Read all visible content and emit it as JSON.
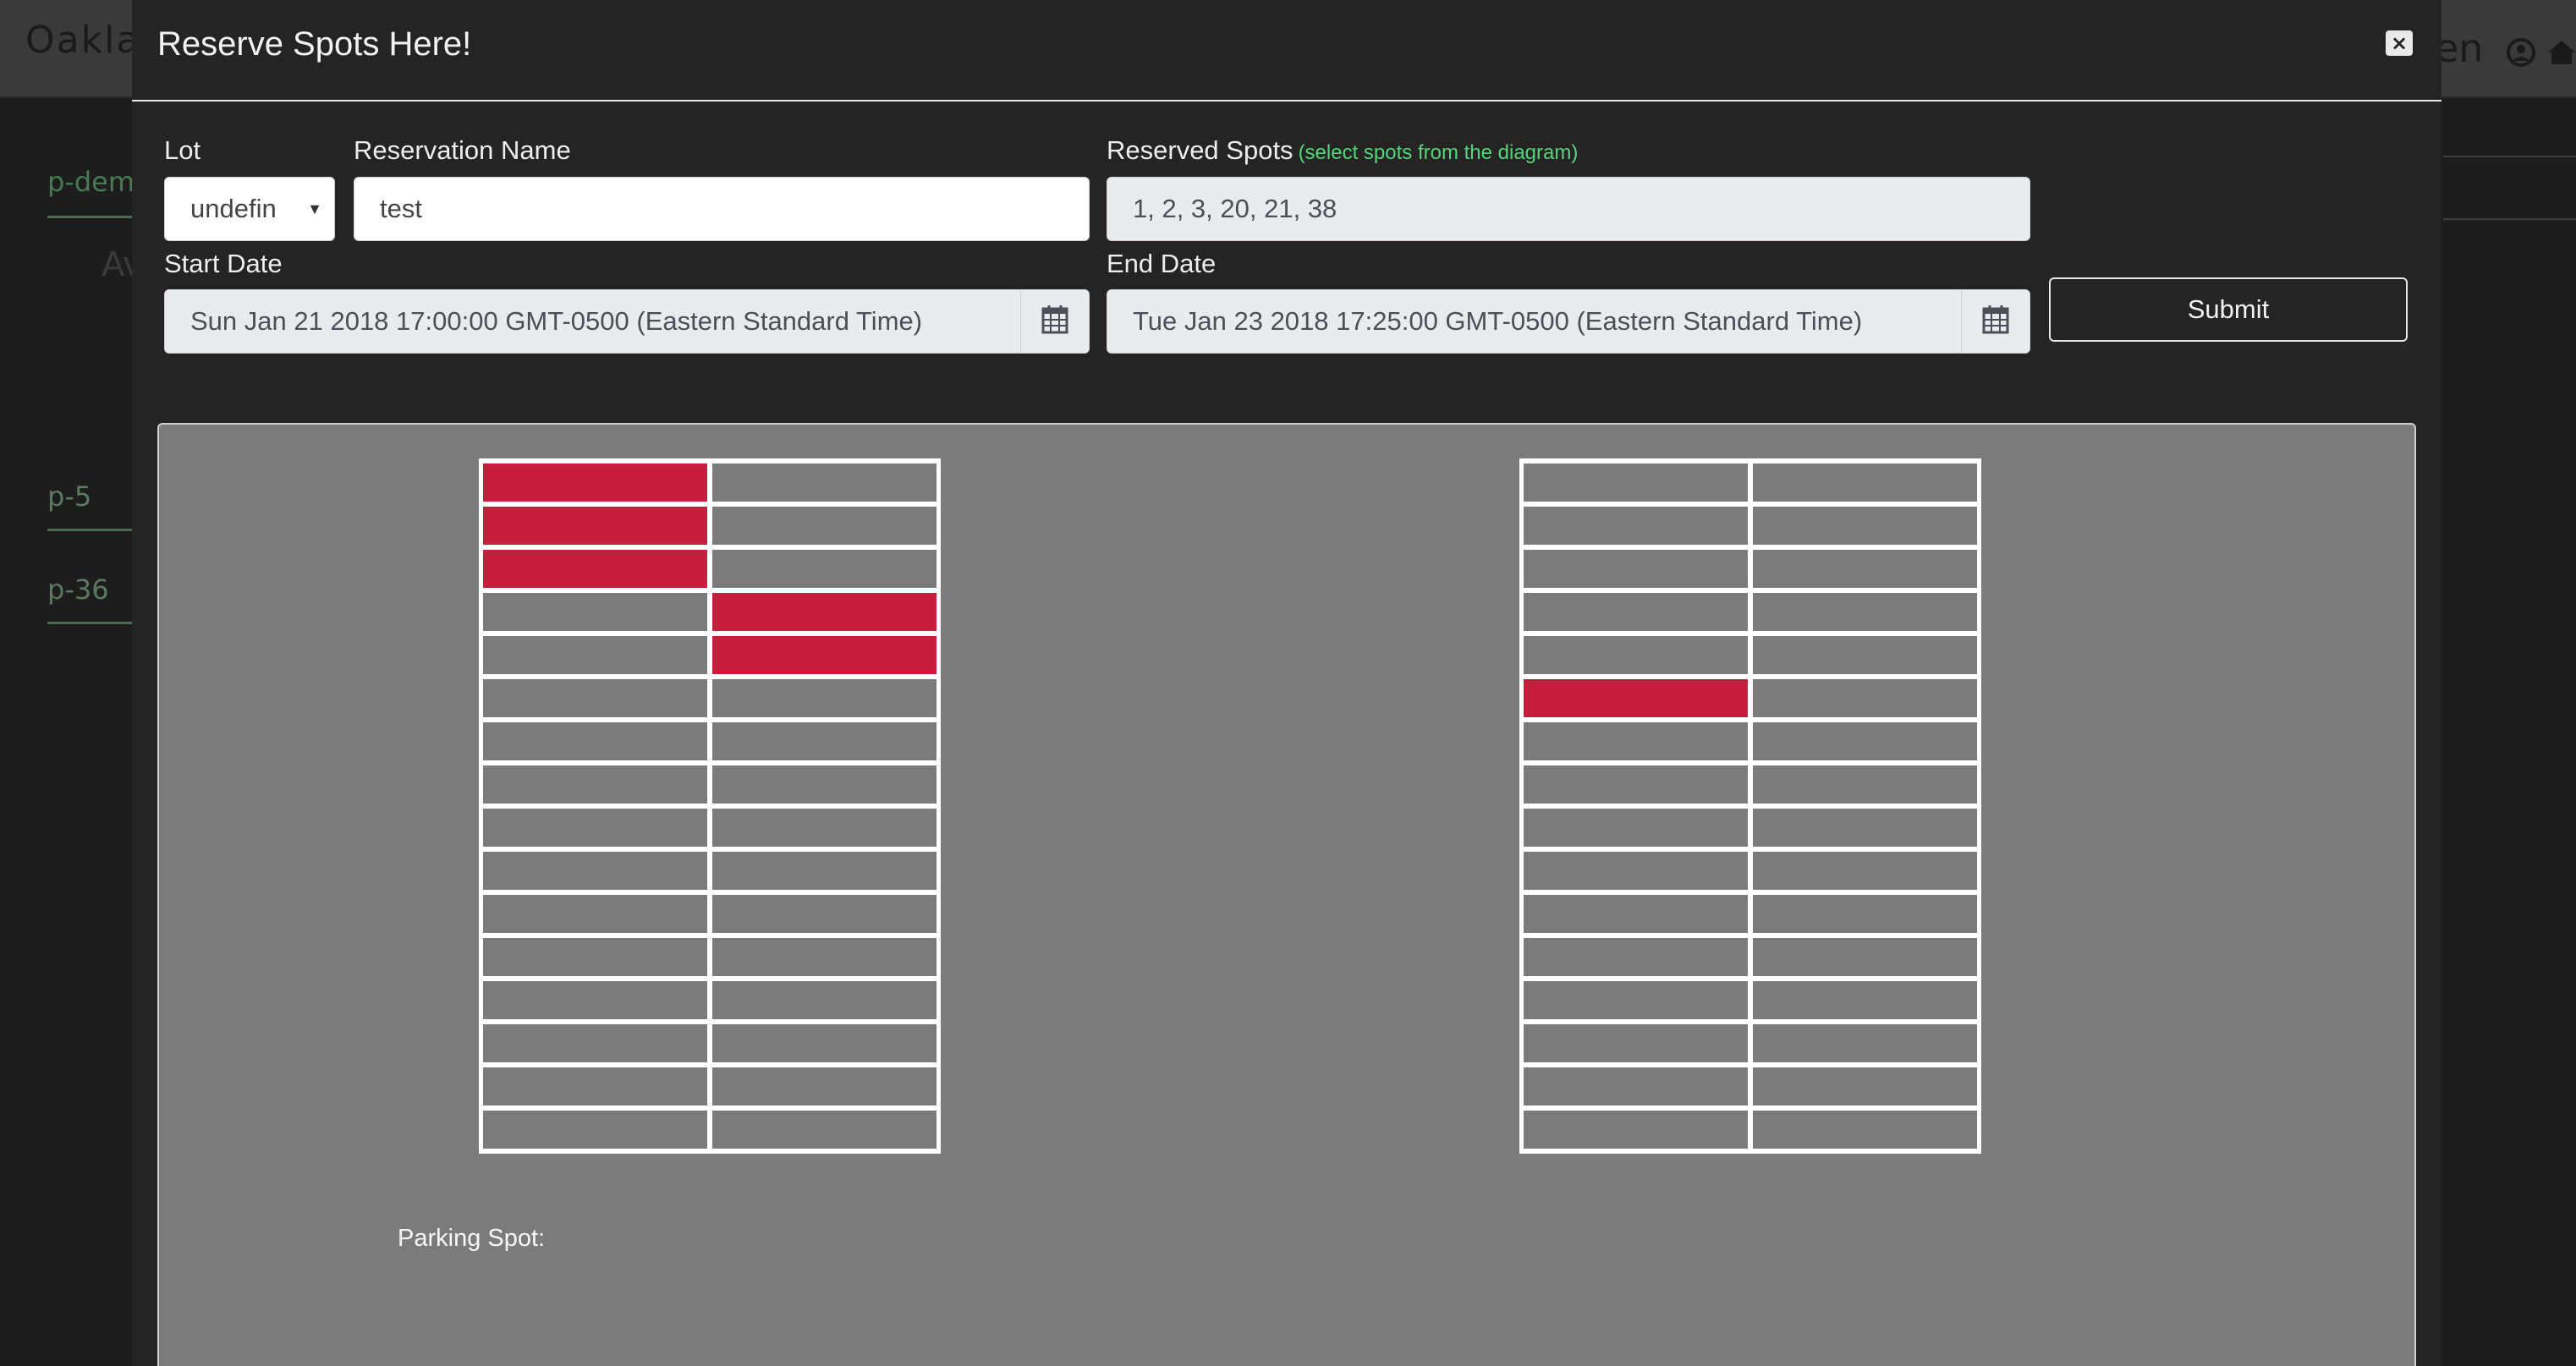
{
  "app": {
    "brand": "Oakla",
    "top_right_text": "en",
    "sidebar": [
      {
        "label": "p-dem",
        "color": "#4a7a55"
      },
      {
        "label": "Av",
        "color": "#3a3a3a"
      },
      {
        "label": "p-5",
        "color": "#5a7a60"
      },
      {
        "label": "p-36",
        "color": "#5a7a60"
      }
    ],
    "icons": [
      "user-circle-icon",
      "home-icon"
    ]
  },
  "modal": {
    "title": "Reserve Spots Here!",
    "close_label": "×",
    "lot": {
      "label": "Lot",
      "value": "undefin"
    },
    "reservation_name": {
      "label": "Reservation Name",
      "value": "test"
    },
    "reserved_spots": {
      "label": "Reserved Spots",
      "hint": "(select spots from the diagram)",
      "value": "1, 2, 3, 20, 21, 38"
    },
    "start_date": {
      "label": "Start Date",
      "value": "Sun Jan 21 2018 17:00:00 GMT-0500 (Eastern Standard Time)"
    },
    "end_date": {
      "label": "End Date",
      "value": "Tue Jan 23 2018 17:25:00 GMT-0500 (Eastern Standard Time)"
    },
    "submit_label": "Submit",
    "diagram": {
      "parking_spot_label": "Parking Spot:",
      "reserved_color": "#c81d3c",
      "lots": [
        {
          "name": "left",
          "rows": 16,
          "columns": 2,
          "reserved": [
            [
              0,
              0
            ],
            [
              1,
              0
            ],
            [
              2,
              0
            ],
            [
              3,
              1
            ],
            [
              4,
              1
            ]
          ]
        },
        {
          "name": "right",
          "rows": 16,
          "columns": 2,
          "reserved": [
            [
              5,
              0
            ]
          ]
        }
      ]
    }
  }
}
